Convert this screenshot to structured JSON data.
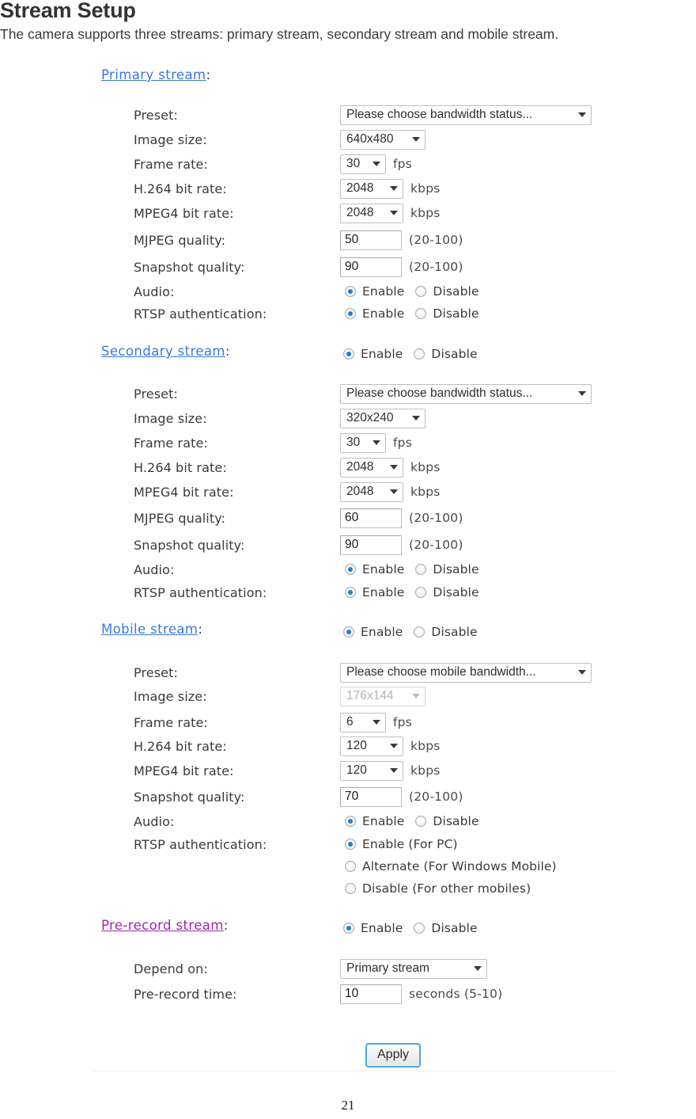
{
  "header": {
    "title": "Stream Setup",
    "subtitle": "The camera supports three streams: primary stream, secondary stream and mobile stream."
  },
  "labels": {
    "preset": "Preset:",
    "image_size": "Image size:",
    "frame_rate": "Frame rate:",
    "h264_bit_rate": "H.264 bit rate:",
    "mpeg4_bit_rate": "MPEG4 bit rate:",
    "mjpeg_quality": "MJPEG quality:",
    "snapshot_quality": "Snapshot quality:",
    "audio": "Audio:",
    "rtsp_auth": "RTSP authentication:",
    "depend_on": "Depend on:",
    "prerecord_time": "Pre-record time:"
  },
  "units": {
    "fps": "fps",
    "kbps": "kbps",
    "range_20_100": "(20-100)",
    "seconds_range": "seconds (5-10)"
  },
  "radio_labels": {
    "enable": "Enable",
    "disable": "Disable",
    "enable_for_pc": "Enable (For PC)",
    "alternate_windows_mobile": "Alternate (For Windows Mobile)",
    "disable_other_mobiles": "Disable (For other mobiles)"
  },
  "primary": {
    "heading_link": "Primary stream",
    "heading_colon": ":",
    "preset": "Please choose bandwidth status...",
    "image_size": "640x480",
    "frame_rate": "30",
    "h264_bit_rate": "2048",
    "mpeg4_bit_rate": "2048",
    "mjpeg_quality": "50",
    "snapshot_quality": "90",
    "audio_selected": "enable",
    "rtsp_selected": "enable"
  },
  "secondary": {
    "heading_link": "Secondary stream",
    "heading_colon": ":",
    "stream_selected": "enable",
    "preset": "Please choose bandwidth status...",
    "image_size": "320x240",
    "frame_rate": "30",
    "h264_bit_rate": "2048",
    "mpeg4_bit_rate": "2048",
    "mjpeg_quality": "60",
    "snapshot_quality": "90",
    "audio_selected": "enable",
    "rtsp_selected": "enable"
  },
  "mobile": {
    "heading_link": "Mobile stream",
    "heading_colon": ":",
    "stream_selected": "enable",
    "preset": "Please choose mobile bandwidth...",
    "image_size": "176x144",
    "image_size_disabled": true,
    "frame_rate": "6",
    "h264_bit_rate": "120",
    "mpeg4_bit_rate": "120",
    "snapshot_quality": "70",
    "audio_selected": "enable",
    "rtsp_selected": "enable_for_pc"
  },
  "prerecord": {
    "heading_link": "Pre-record stream",
    "heading_colon": ":",
    "stream_selected": "enable",
    "depend_on": "Primary stream",
    "prerecord_time": "10"
  },
  "apply": {
    "label": "Apply"
  },
  "footer": {
    "page_number": "21"
  },
  "colors": {
    "link": "#3b78d8",
    "link_visited": "#9c27b0",
    "radio_dot": "#1b7fd4",
    "apply_focus_ring": "#4aa8e0",
    "text": "#3a3a3a"
  }
}
